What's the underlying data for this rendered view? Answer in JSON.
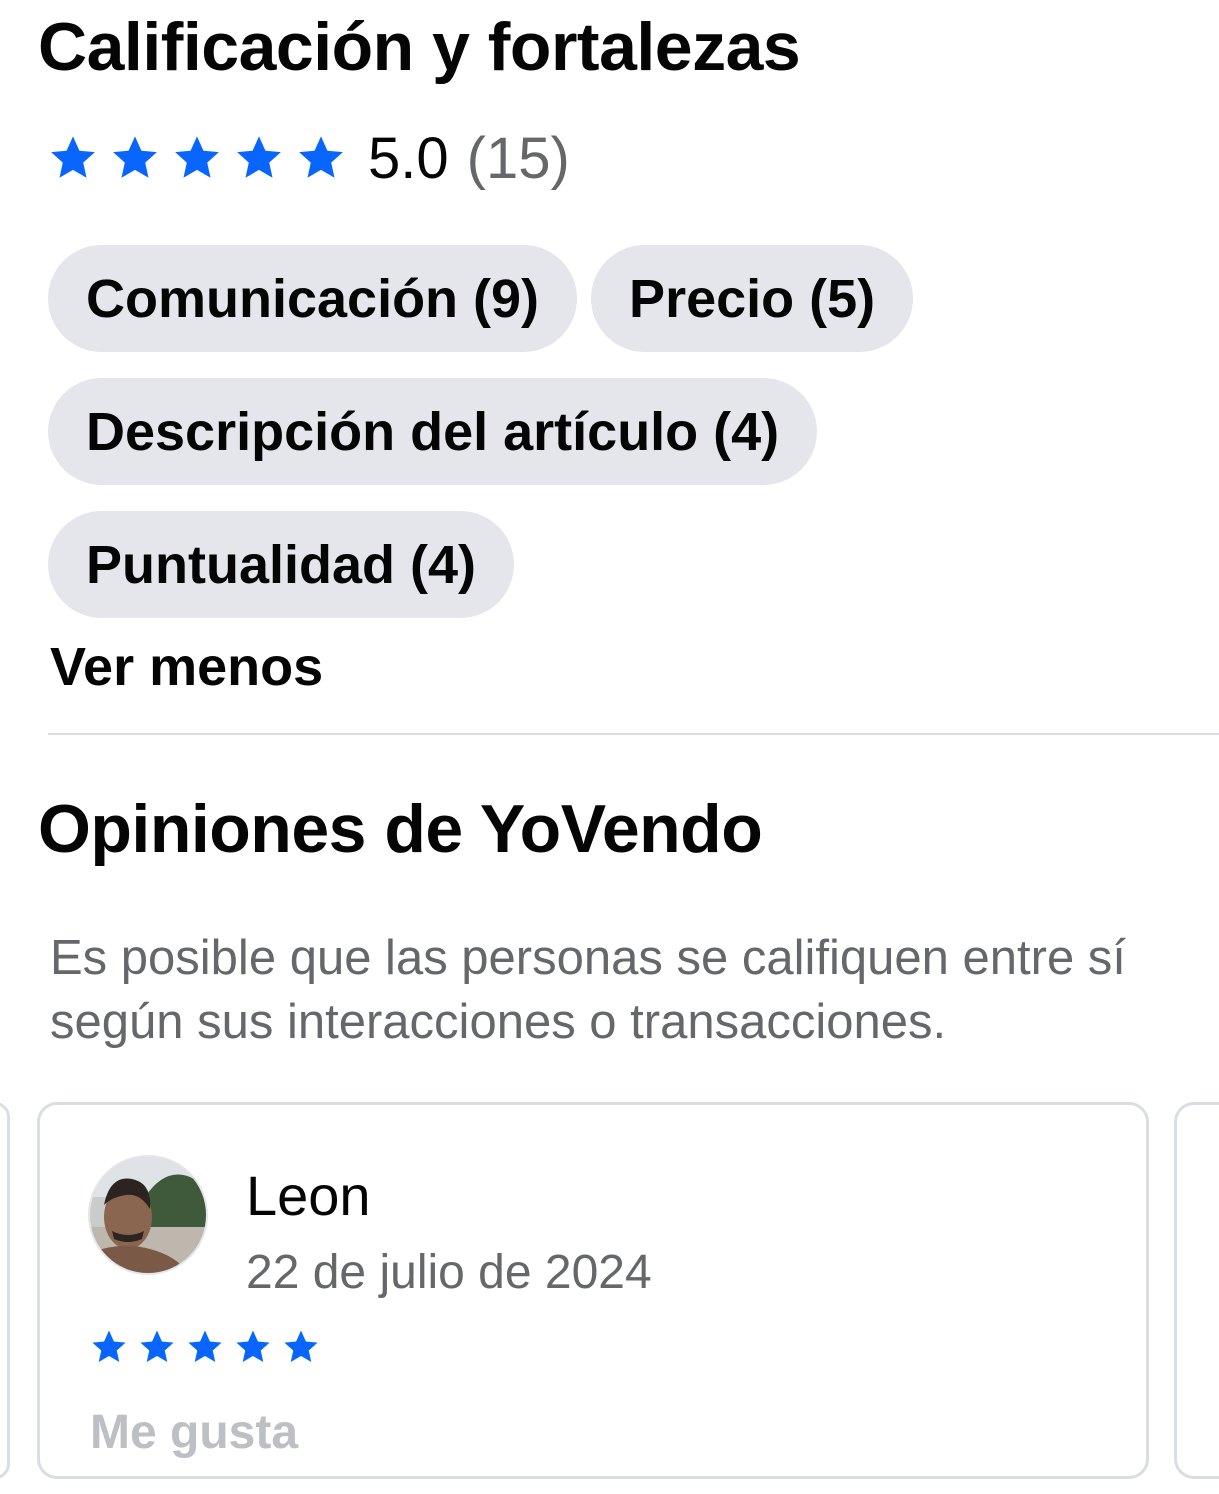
{
  "rating_section": {
    "title": "Calificación y fortalezas",
    "stars": 5,
    "score": "5.0",
    "count": "(15)",
    "chips": [
      {
        "label": "Comunicación (9)"
      },
      {
        "label": "Precio (5)"
      },
      {
        "label": "Descripción del artículo (4)"
      },
      {
        "label": "Puntualidad (4)"
      }
    ],
    "see_less_label": "Ver menos"
  },
  "reviews_section": {
    "title": "Opiniones de YoVendo",
    "description": "Es posible que las personas se califiquen entre sí según sus interacciones o transacciones.",
    "reviews": [
      {
        "name": "Leon",
        "date": "22 de julio de 2024",
        "stars": 5,
        "like_label": "Me gusta"
      }
    ]
  },
  "colors": {
    "star": "#0866ff",
    "chip_bg": "#e4e6eb",
    "secondary_text": "#65676b",
    "disabled_text": "#bcc0c4"
  },
  "icons": {
    "star": "star-icon"
  }
}
